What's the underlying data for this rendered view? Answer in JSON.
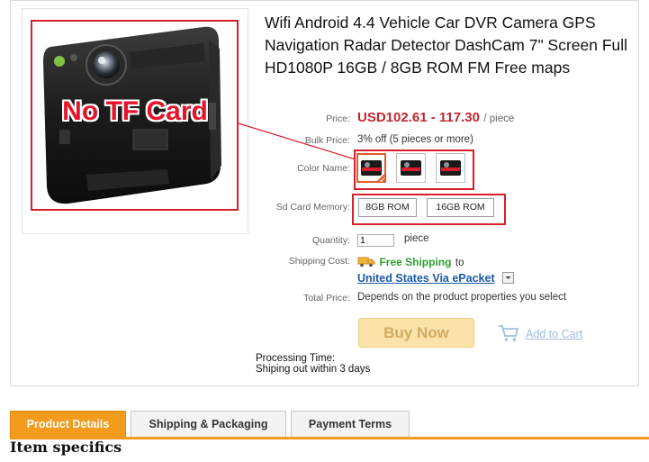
{
  "product": {
    "title": "Wifi Android 4.4 Vehicle Car DVR Camera GPS Navigation Radar Detector DashCam 7\" Screen Full HD1080P 16GB / 8GB ROM FM Free maps",
    "image_overlay_text": "No TF Card"
  },
  "price": {
    "label": "Price:",
    "value": "USD102.61 - 117.30",
    "unit": "/ piece"
  },
  "bulk": {
    "label": "Bulk Price:",
    "value": "3% off (5 pieces or more)"
  },
  "color": {
    "label": "Color Name:",
    "selected_index": 0,
    "swatch_count": 3
  },
  "memory": {
    "label": "Sd Card Memory:",
    "options": [
      "8GB ROM",
      "16GB ROM"
    ]
  },
  "quantity": {
    "label": "Quantity:",
    "value": "1",
    "unit": "piece"
  },
  "shipping": {
    "label": "Shipping Cost:",
    "free": "Free Shipping",
    "to": "to",
    "destination": "United States Via ePacket"
  },
  "total": {
    "label": "Total Price:",
    "value": "Depends on the product properties you select"
  },
  "actions": {
    "buy_now": "Buy Now",
    "add_to_cart": "Add to Cart"
  },
  "processing": {
    "label": "Processing Time:",
    "value": "Shiping out within 3 days"
  },
  "tabs": [
    {
      "label": "Product Details",
      "active": true
    },
    {
      "label": "Shipping & Packaging",
      "active": false
    },
    {
      "label": "Payment Terms",
      "active": false
    }
  ],
  "section_heading": "Item specifics",
  "colors": {
    "accent": "#f39b1c",
    "price": "#c1272d",
    "highlight": "#d81e2c",
    "free_shipping": "#2aa12e",
    "link": "#1c5aa6"
  }
}
